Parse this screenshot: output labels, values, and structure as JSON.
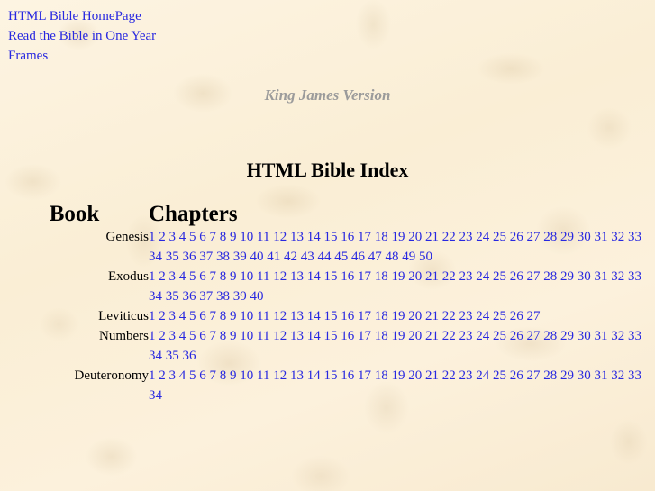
{
  "nav": {
    "links": [
      {
        "label": "HTML Bible HomePage",
        "name": "nav-link-homepage"
      },
      {
        "label": "Read the Bible in One Year",
        "name": "nav-link-one-year"
      },
      {
        "label": "Frames",
        "name": "nav-link-frames"
      }
    ]
  },
  "header": {
    "version": "King James Version",
    "title": "HTML Bible Index"
  },
  "table": {
    "columns": {
      "book": "Book",
      "chapters": "Chapters"
    },
    "rows": [
      {
        "book": "Genesis",
        "chapter_count": 50
      },
      {
        "book": "Exodus",
        "chapter_count": 40
      },
      {
        "book": "Leviticus",
        "chapter_count": 27
      },
      {
        "book": "Numbers",
        "chapter_count": 36
      },
      {
        "book": "Deuteronomy",
        "chapter_count": 34
      }
    ]
  },
  "colors": {
    "link": "#2828e0",
    "version_text": "#9b9b9b",
    "background": "#fbf0d9",
    "text": "#000000"
  }
}
